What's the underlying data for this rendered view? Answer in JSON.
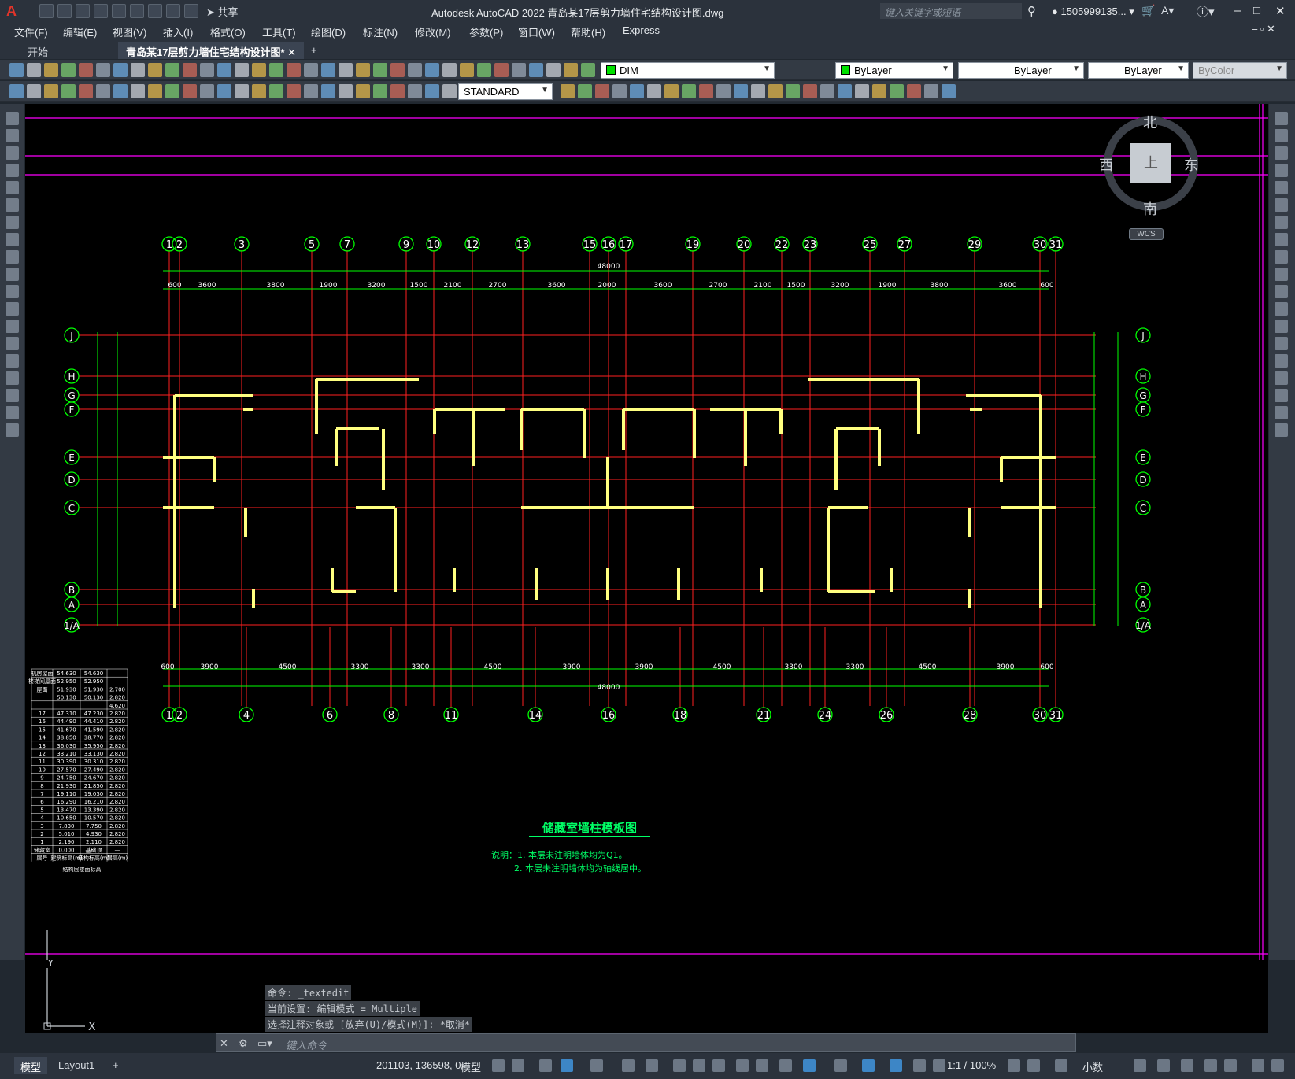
{
  "app": {
    "title": "Autodesk AutoCAD 2022    青岛某17层剪力墙住宅结构设计图.dwg",
    "share_label": "共享"
  },
  "search": {
    "placeholder": "键入关键字或短语"
  },
  "user": {
    "name": "1505999135..."
  },
  "menu": [
    "文件(F)",
    "编辑(E)",
    "视图(V)",
    "插入(I)",
    "格式(O)",
    "工具(T)",
    "绘图(D)",
    "标注(N)",
    "修改(M)",
    "参数(P)",
    "窗口(W)",
    "帮助(H)",
    "Express"
  ],
  "tabs": {
    "start": "开始",
    "active": "青岛某17层剪力墙住宅结构设计图*",
    "add": "+"
  },
  "toolbar": {
    "layer": "DIM",
    "color": "ByLayer",
    "linetype": "ByLayer",
    "lineweight": "ByLayer",
    "plotstyle": "ByColor",
    "dimstyle": "STANDARD",
    "accent_green": "#00e000"
  },
  "viewcube": {
    "north": "北",
    "south": "南",
    "east": "东",
    "west": "西",
    "top": "上",
    "wcs": "WCS"
  },
  "drawing": {
    "grid_top": [
      "1",
      "2",
      "3",
      "5",
      "7",
      "9",
      "10",
      "12",
      "13",
      "15",
      "16",
      "17",
      "19",
      "20",
      "22",
      "23",
      "25",
      "27",
      "29",
      "30",
      "31"
    ],
    "grid_bottom": [
      "1",
      "2",
      "4",
      "6",
      "8",
      "11",
      "14",
      "16",
      "18",
      "21",
      "24",
      "26",
      "28",
      "30",
      "31"
    ],
    "grid_left": [
      "J",
      "H",
      "G",
      "F",
      "E",
      "D",
      "C",
      "B",
      "A",
      "1/A"
    ],
    "dims_top": [
      "600",
      "3600",
      "3800",
      "1900",
      "3200",
      "1500",
      "2100",
      "2700",
      "3600",
      "2000",
      "3600",
      "2700",
      "2100",
      "1500",
      "3200",
      "1900",
      "3800",
      "3600",
      "600"
    ],
    "dims_bottom": [
      "600",
      "3900",
      "4500",
      "3300",
      "3300",
      "4500",
      "3900",
      "3900",
      "4500",
      "3300",
      "3300",
      "4500",
      "3900",
      "600"
    ],
    "total_width": "48000",
    "title": "储藏室墙柱模板图",
    "note1": "说明：1. 本层未注明墙体均为Q1。",
    "note2": "2. 本层未注明墙体均为轴线居中。",
    "level_table": [
      [
        "机房屋面",
        "54.630",
        "54.630",
        ""
      ],
      [
        "楼梯间屋面",
        "52.950",
        "52.950",
        ""
      ],
      [
        "屋面",
        "51.930",
        "51.930",
        "2.700"
      ],
      [
        "",
        "50.130",
        "50.130",
        "2.820"
      ],
      [
        "",
        "",
        "",
        "4.620"
      ],
      [
        "17",
        "47.310",
        "47.230",
        "2.820"
      ],
      [
        "16",
        "44.490",
        "44.410",
        "2.820"
      ],
      [
        "15",
        "41.670",
        "41.590",
        "2.820"
      ],
      [
        "14",
        "38.850",
        "38.770",
        "2.820"
      ],
      [
        "13",
        "36.030",
        "35.950",
        "2.820"
      ],
      [
        "12",
        "33.210",
        "33.130",
        "2.820"
      ],
      [
        "11",
        "30.390",
        "30.310",
        "2.820"
      ],
      [
        "10",
        "27.570",
        "27.490",
        "2.820"
      ],
      [
        "9",
        "24.750",
        "24.670",
        "2.820"
      ],
      [
        "8",
        "21.930",
        "21.850",
        "2.820"
      ],
      [
        "7",
        "19.110",
        "19.030",
        "2.820"
      ],
      [
        "6",
        "16.290",
        "16.210",
        "2.820"
      ],
      [
        "5",
        "13.470",
        "13.390",
        "2.820"
      ],
      [
        "4",
        "10.650",
        "10.570",
        "2.820"
      ],
      [
        "3",
        "7.830",
        "7.750",
        "2.820"
      ],
      [
        "2",
        "5.010",
        "4.930",
        "2.820"
      ],
      [
        "1",
        "2.190",
        "2.110",
        "2.820"
      ],
      [
        "储藏室",
        "0.000",
        "基础顶",
        "—"
      ],
      [
        "层号",
        "建筑标高(m)",
        "结构标高(m)",
        "层高(m)"
      ]
    ],
    "table_caption": "结构层楼面标高",
    "colors": {
      "grid_line": "#ff2020",
      "dim_line": "#00ff00",
      "wall": "#ffff80",
      "magenta": "#ff00ff",
      "text": "#00ff66"
    }
  },
  "command": {
    "line1": "命令: _textedit",
    "line2": "当前设置: 编辑模式 = Multiple",
    "line3": "选择注释对象或 [放弃(U)/模式(M)]: *取消*",
    "input_placeholder": "键入命令"
  },
  "status": {
    "model_tab": "模型",
    "layout1": "Layout1",
    "coords": "201103, 136598, 0",
    "model_btn": "模型",
    "scale": "1:1 / 100%",
    "units": "小数"
  }
}
